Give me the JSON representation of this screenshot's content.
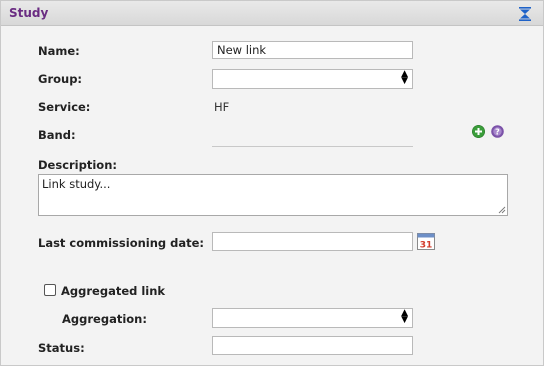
{
  "panel": {
    "title": "Study",
    "collapse_icon": "collapse-up-icon"
  },
  "form": {
    "name_label": "Name:",
    "name_value": "New link",
    "group_label": "Group:",
    "group_value": "",
    "service_label": "Service:",
    "service_value": "HF",
    "band_label": "Band:",
    "band_value": "",
    "add_icon": "add-icon",
    "help_icon": "help-icon",
    "description_label": "Description:",
    "description_value": "Link study...",
    "commissioning_label": "Last commissioning date:",
    "commissioning_value": "",
    "calendar_icon": "calendar-icon",
    "calendar_day": "31",
    "aggregated_label": "Aggregated link",
    "aggregated_checked": false,
    "aggregation_label": "Aggregation:",
    "aggregation_value": "",
    "status_label": "Status:",
    "status_value": ""
  },
  "colors": {
    "title": "#6a2c82",
    "add_icon": "#3a9d3a",
    "help_icon": "#7b52a8",
    "collapse_icon": "#1e62c8"
  }
}
